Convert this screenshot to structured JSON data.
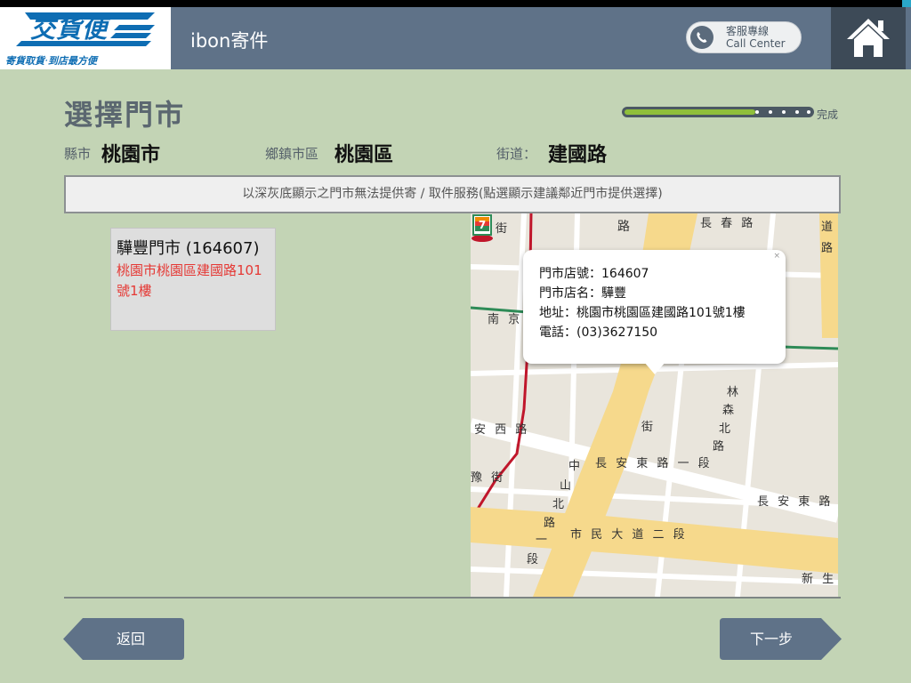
{
  "header": {
    "logo_text": "交貨便",
    "logo_tagline": "寄貨取貨‧到店最方便",
    "title": "ibon寄件",
    "call_center_zh": "客服專線",
    "call_center_en": "Call Center"
  },
  "page": {
    "title": "選擇門市",
    "progress_label": "完成",
    "progress_value": 0.7
  },
  "filters": {
    "city_label": "縣市",
    "city_value": "桃園市",
    "district_label": "鄉鎮市區",
    "district_value": "桃園區",
    "street_label": "街道：",
    "street_value": "建國路"
  },
  "notice": "以深灰底顯示之門市無法提供寄 / 取件服務(點選顯示建議鄰近門市提供選擇)",
  "stores": [
    {
      "name": "驊豐門市 (164607)",
      "address": "桃園市桃園區建國路101號1樓"
    }
  ],
  "map": {
    "popup": {
      "store_no": "門市店號：164607",
      "store_name": "門市店名：驊豐",
      "address": "地址：桃園市桃園區建國路101號1樓",
      "phone": "電話：(03)3627150"
    },
    "labels": {
      "jie_top": "街",
      "lu_top": "路",
      "changchun": "長 春 路",
      "dao": "道",
      "lu_right": "路",
      "nanjing": "南 京",
      "lin": "林",
      "sen": "森",
      "bei": "北",
      "lu_lin": "路",
      "jie_mid": "街",
      "anxi": "安 西 路",
      "zhong": "中",
      "shan": "山",
      "bei2": "北",
      "lu2": "路",
      "yi": "一",
      "duan": "段",
      "changan": "長 安 東 路 一 段",
      "changan2": "長 安 東 路 二",
      "jie_left": "豫 街",
      "shimin": "市 民 大 道 二 段",
      "xin": "新 生"
    }
  },
  "nav": {
    "back": "返回",
    "next": "下一步"
  },
  "colors": {
    "background": "#c3d4b5",
    "header": "#5f7288",
    "progress_fill": "#8fbf3b",
    "address_red": "#e53935",
    "button": "#5f7288"
  }
}
